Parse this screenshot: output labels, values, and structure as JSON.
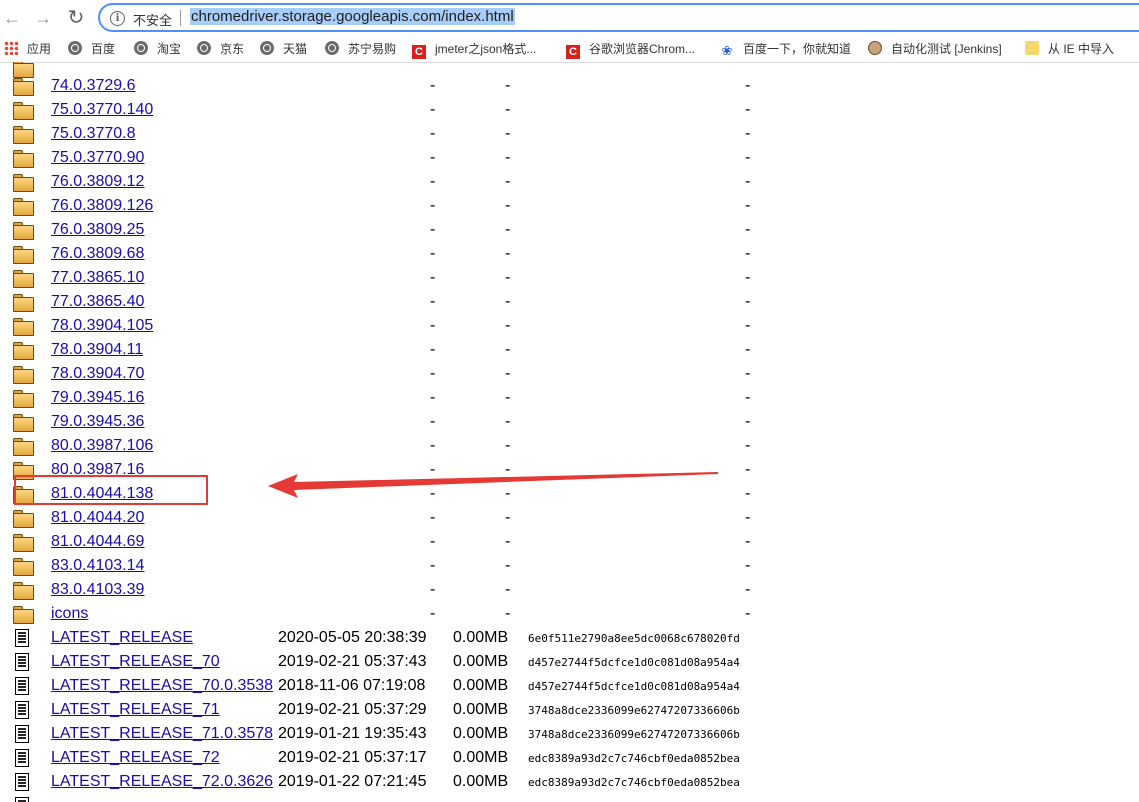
{
  "browser": {
    "security_label": "不安全",
    "url": "chromedriver.storage.googleapis.com/index.html"
  },
  "bookmarks": [
    {
      "label": "应用",
      "icon": "apps-grid-icon"
    },
    {
      "label": "百度",
      "icon": "globe-icon"
    },
    {
      "label": "淘宝",
      "icon": "globe-icon"
    },
    {
      "label": "京东",
      "icon": "globe-icon"
    },
    {
      "label": "天猫",
      "icon": "globe-icon"
    },
    {
      "label": "苏宁易购",
      "icon": "globe-icon"
    },
    {
      "label": "jmeter之json格式...",
      "icon": "csdn-icon"
    },
    {
      "label": "谷歌浏览器Chrom...",
      "icon": "csdn-icon"
    },
    {
      "label": "百度一下，你就知道",
      "icon": "baidu-paw-icon"
    },
    {
      "label": "自动化测试 [Jenkins]",
      "icon": "jenkins-icon"
    },
    {
      "label": "从 IE 中导入",
      "icon": "folder-bookmark-icon"
    }
  ],
  "listing": {
    "dash": "-",
    "folders": [
      "74.0.3729.6",
      "75.0.3770.140",
      "75.0.3770.8",
      "75.0.3770.90",
      "76.0.3809.12",
      "76.0.3809.126",
      "76.0.3809.25",
      "76.0.3809.68",
      "77.0.3865.10",
      "77.0.3865.40",
      "78.0.3904.105",
      "78.0.3904.11",
      "78.0.3904.70",
      "79.0.3945.16",
      "79.0.3945.36",
      "80.0.3987.106",
      "80.0.3987.16",
      "81.0.4044.138",
      "81.0.4044.20",
      "81.0.4044.69",
      "83.0.4103.14",
      "83.0.4103.39",
      "icons"
    ],
    "files": [
      {
        "name": "LATEST_RELEASE",
        "date": "2020-05-05 20:38:39",
        "size": "0.00MB",
        "etag": "6e0f511e2790a8ee5dc0068c678020fd"
      },
      {
        "name": "LATEST_RELEASE_70",
        "date": "2019-02-21 05:37:43",
        "size": "0.00MB",
        "etag": "d457e2744f5dcfce1d0c081d08a954a4"
      },
      {
        "name": "LATEST_RELEASE_70.0.3538",
        "date": "2018-11-06 07:19:08",
        "size": "0.00MB",
        "etag": "d457e2744f5dcfce1d0c081d08a954a4"
      },
      {
        "name": "LATEST_RELEASE_71",
        "date": "2019-02-21 05:37:29",
        "size": "0.00MB",
        "etag": "3748a8dce2336099e62747207336606b"
      },
      {
        "name": "LATEST_RELEASE_71.0.3578",
        "date": "2019-01-21 19:35:43",
        "size": "0.00MB",
        "etag": "3748a8dce2336099e62747207336606b"
      },
      {
        "name": "LATEST_RELEASE_72",
        "date": "2019-02-21 05:37:17",
        "size": "0.00MB",
        "etag": "edc8389a93d2c7c746cbf0eda0852bea"
      },
      {
        "name": "LATEST_RELEASE_72.0.3626",
        "date": "2019-01-22 07:21:45",
        "size": "0.00MB",
        "etag": "edc8389a93d2c7c746cbf0eda0852bea"
      }
    ]
  },
  "annotation": {
    "highlighted_folder": "81.0.4044.138",
    "color": "#e53935"
  }
}
